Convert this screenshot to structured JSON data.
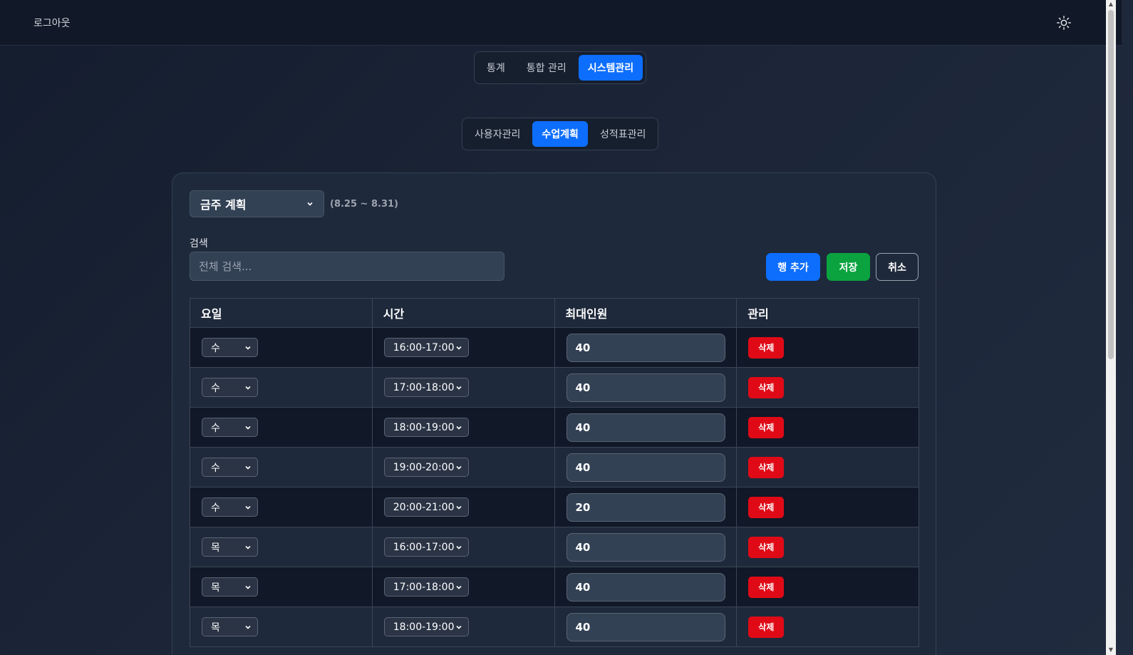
{
  "topbar": {
    "logout_label": "로그아웃",
    "theme_icon": "sun-icon"
  },
  "main_tabs": [
    {
      "label": "통계",
      "active": false
    },
    {
      "label": "통합 관리",
      "active": false
    },
    {
      "label": "시스템관리",
      "active": true
    }
  ],
  "sub_tabs": [
    {
      "label": "사용자관리",
      "active": false
    },
    {
      "label": "수업계획",
      "active": true
    },
    {
      "label": "성적표관리",
      "active": false
    }
  ],
  "plan": {
    "week_select": "금주 계획",
    "date_range": "(8.25 ~ 8.31)",
    "search_label": "검색",
    "search_placeholder": "전체 검색...",
    "add_row_label": "행 추가",
    "save_label": "저장",
    "cancel_label": "취소"
  },
  "table": {
    "headers": [
      "요일",
      "시간",
      "최대인원",
      "관리"
    ],
    "delete_label": "삭제",
    "rows": [
      {
        "day": "수",
        "time": "16:00-17:00",
        "max": "40"
      },
      {
        "day": "수",
        "time": "17:00-18:00",
        "max": "40"
      },
      {
        "day": "수",
        "time": "18:00-19:00",
        "max": "40"
      },
      {
        "day": "수",
        "time": "19:00-20:00",
        "max": "40"
      },
      {
        "day": "수",
        "time": "20:00-21:00",
        "max": "20"
      },
      {
        "day": "목",
        "time": "16:00-17:00",
        "max": "40"
      },
      {
        "day": "목",
        "time": "17:00-18:00",
        "max": "40"
      },
      {
        "day": "목",
        "time": "18:00-19:00",
        "max": "40"
      }
    ]
  },
  "colors": {
    "accent": "#0d6efd",
    "success": "#0aa33f",
    "danger": "#e00a17",
    "background": "#1e293b"
  }
}
